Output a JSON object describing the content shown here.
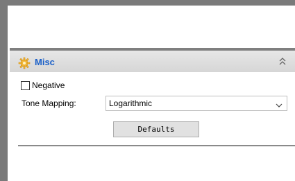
{
  "misc_section": {
    "title": "Misc",
    "icon": "gear-icon",
    "collapse_icon": "double-chevron-up-icon"
  },
  "negative": {
    "label": "Negative",
    "checked": false
  },
  "tone_mapping": {
    "label": "Tone Mapping:",
    "selected": "Logarithmic"
  },
  "defaults_button": {
    "label": "Defaults"
  },
  "colors": {
    "section_title": "#1a5fc8",
    "frame": "#7a7a7a",
    "header_bg": "#dcdcdc",
    "button_bg": "#e1e1e1"
  }
}
